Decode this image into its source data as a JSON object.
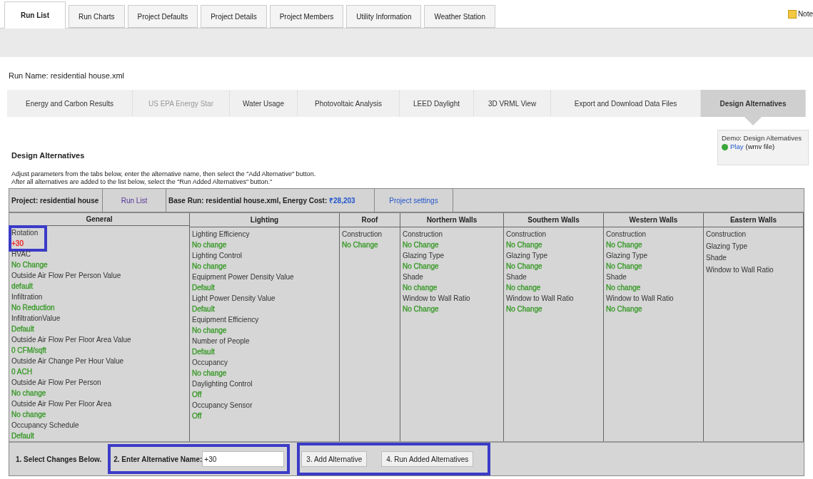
{
  "top_tabs": [
    {
      "label": "Run List",
      "selected": true
    },
    {
      "label": "Run Charts",
      "selected": false
    },
    {
      "label": "Project Defaults",
      "selected": false
    },
    {
      "label": "Project Details",
      "selected": false
    },
    {
      "label": "Project Members",
      "selected": false
    },
    {
      "label": "Utility Information",
      "selected": false
    },
    {
      "label": "Weather Station",
      "selected": false
    }
  ],
  "notes_link": "Note",
  "run_name": "Run Name: residential house.xml",
  "sub_tabs": [
    {
      "label": "Energy and Carbon Results",
      "selected": false,
      "disabled": false
    },
    {
      "label": "US EPA Energy Star",
      "selected": false,
      "disabled": true
    },
    {
      "label": "Water Usage",
      "selected": false,
      "disabled": false
    },
    {
      "label": "Photovoltaic Analysis",
      "selected": false,
      "disabled": false
    },
    {
      "label": "LEED Daylight",
      "selected": false,
      "disabled": false
    },
    {
      "label": "3D VRML View",
      "selected": false,
      "disabled": false
    },
    {
      "label": "Export and Download Data Files",
      "selected": false,
      "disabled": false
    },
    {
      "label": "Design Alternatives",
      "selected": true,
      "disabled": false
    }
  ],
  "section_title": "Design Alternatives",
  "instructions": [
    "Adjust parameters from the tabs below, enter the alternative name, then select the \"Add Alternative\" button.",
    "After all alternatives are added to the list below, select the \"Run Added Alternatives\" button.\""
  ],
  "demo": {
    "title": "Demo: Design Alternatives",
    "link": "Play",
    "note": "(wmv file)"
  },
  "project_bar": {
    "project": "Project: residential house",
    "run_list": "Run List",
    "base_run": "Base Run: residential house.xml, Energy Cost: ",
    "cost": "₹28,203",
    "settings": "Project settings"
  },
  "columns": [
    {
      "heading": "General",
      "items": [
        {
          "label": "Rotation",
          "value": "+30",
          "color": "#ee2222",
          "highlighted": true
        },
        {
          "label": "HVAC",
          "value": "No Change",
          "color": "#3a9a2a",
          "highlighted": false
        },
        {
          "label": "Outside Air Flow Per Person Value",
          "value": "default",
          "color": "#3a9a2a",
          "highlighted": false
        },
        {
          "label": "Infiltration",
          "value": "No Reduction",
          "color": "#3a9a2a",
          "highlighted": false
        },
        {
          "label": "InfiltrationValue",
          "value": "Default",
          "color": "#3a9a2a",
          "highlighted": false
        },
        {
          "label": "Outside Air Flow Per Floor Area Value",
          "value": "0 CFM/sqft",
          "color": "#3a9a2a",
          "highlighted": false
        },
        {
          "label": "Outside Air Change Per Hour Value",
          "value": "0 ACH",
          "color": "#3a9a2a",
          "highlighted": false
        },
        {
          "label": "Outside Air Flow Per Person",
          "value": "No change",
          "color": "#3a9a2a",
          "highlighted": false
        },
        {
          "label": "Outside Air Flow Per Floor Area",
          "value": "No change",
          "color": "#3a9a2a",
          "highlighted": false
        },
        {
          "label": "Occupancy Schedule",
          "value": "Default",
          "color": "#3a9a2a",
          "highlighted": false
        }
      ]
    },
    {
      "heading": "Lighting",
      "items": [
        {
          "label": "Lighting Efficiency",
          "value": "No change",
          "color": "#3a9a2a",
          "highlighted": false
        },
        {
          "label": "Lighting Control",
          "value": "No change",
          "color": "#3a9a2a",
          "highlighted": false
        },
        {
          "label": "Equipment Power Density Value",
          "value": "Default",
          "color": "#3a9a2a",
          "highlighted": false
        },
        {
          "label": "Light Power Density Value",
          "value": "Default",
          "color": "#3a9a2a",
          "highlighted": false
        },
        {
          "label": "Equipment Efficiency",
          "value": "No change",
          "color": "#3a9a2a",
          "highlighted": false
        },
        {
          "label": "Number of People",
          "value": "Default",
          "color": "#3a9a2a",
          "highlighted": false
        },
        {
          "label": "Occupancy",
          "value": "No change",
          "color": "#3a9a2a",
          "highlighted": false
        },
        {
          "label": "Daylighting Control",
          "value": "Off",
          "color": "#3a9a2a",
          "highlighted": false
        },
        {
          "label": "Occupancy Sensor",
          "value": "Off",
          "color": "#3a9a2a",
          "highlighted": false
        }
      ]
    },
    {
      "heading": "Roof",
      "items": [
        {
          "label": "Construction",
          "value": "No Change",
          "color": "#3a9a2a",
          "highlighted": false
        }
      ]
    },
    {
      "heading": "Northern Walls",
      "items": [
        {
          "label": "Construction",
          "value": "No Change",
          "color": "#3a9a2a",
          "highlighted": false
        },
        {
          "label": "Glazing Type",
          "value": "No Change",
          "color": "#3a9a2a",
          "highlighted": false
        },
        {
          "label": "Shade",
          "value": "No change",
          "color": "#3a9a2a",
          "highlighted": false
        },
        {
          "label": "Window to Wall Ratio",
          "value": "No Change",
          "color": "#3a9a2a",
          "highlighted": false
        }
      ]
    },
    {
      "heading": "Southern Walls",
      "items": [
        {
          "label": "Construction",
          "value": "No Change",
          "color": "#3a9a2a",
          "highlighted": false
        },
        {
          "label": "Glazing Type",
          "value": "No Change",
          "color": "#3a9a2a",
          "highlighted": false
        },
        {
          "label": "Shade",
          "value": "No change",
          "color": "#3a9a2a",
          "highlighted": false
        },
        {
          "label": "Window to Wall Ratio",
          "value": "No Change",
          "color": "#3a9a2a",
          "highlighted": false
        }
      ]
    },
    {
      "heading": "Western Walls",
      "items": [
        {
          "label": "Construction",
          "value": "No Change",
          "color": "#3a9a2a",
          "highlighted": false
        },
        {
          "label": "Glazing Type",
          "value": "No Change",
          "color": "#3a9a2a",
          "highlighted": false
        },
        {
          "label": "Shade",
          "value": "No change",
          "color": "#3a9a2a",
          "highlighted": false
        },
        {
          "label": "Window to Wall Ratio",
          "value": "No Change",
          "color": "#3a9a2a",
          "highlighted": false
        }
      ]
    },
    {
      "heading": "Eastern Walls",
      "items": [
        {
          "label": "Construction",
          "highlighted": false
        },
        {
          "label": "Glazing Type",
          "highlighted": false
        },
        {
          "label": "Shade",
          "highlighted": false
        },
        {
          "label": "Window to Wall Ratio",
          "highlighted": false
        }
      ]
    }
  ],
  "bottom": {
    "step1": "1. Select Changes Below.",
    "name_label": "2. Enter Alternative Name:",
    "name_value": "+30",
    "name_highlighted": true,
    "buttons": [
      "3. Add Alternative",
      "4. Run Added Alternatives"
    ],
    "buttons_highlighted": true
  }
}
